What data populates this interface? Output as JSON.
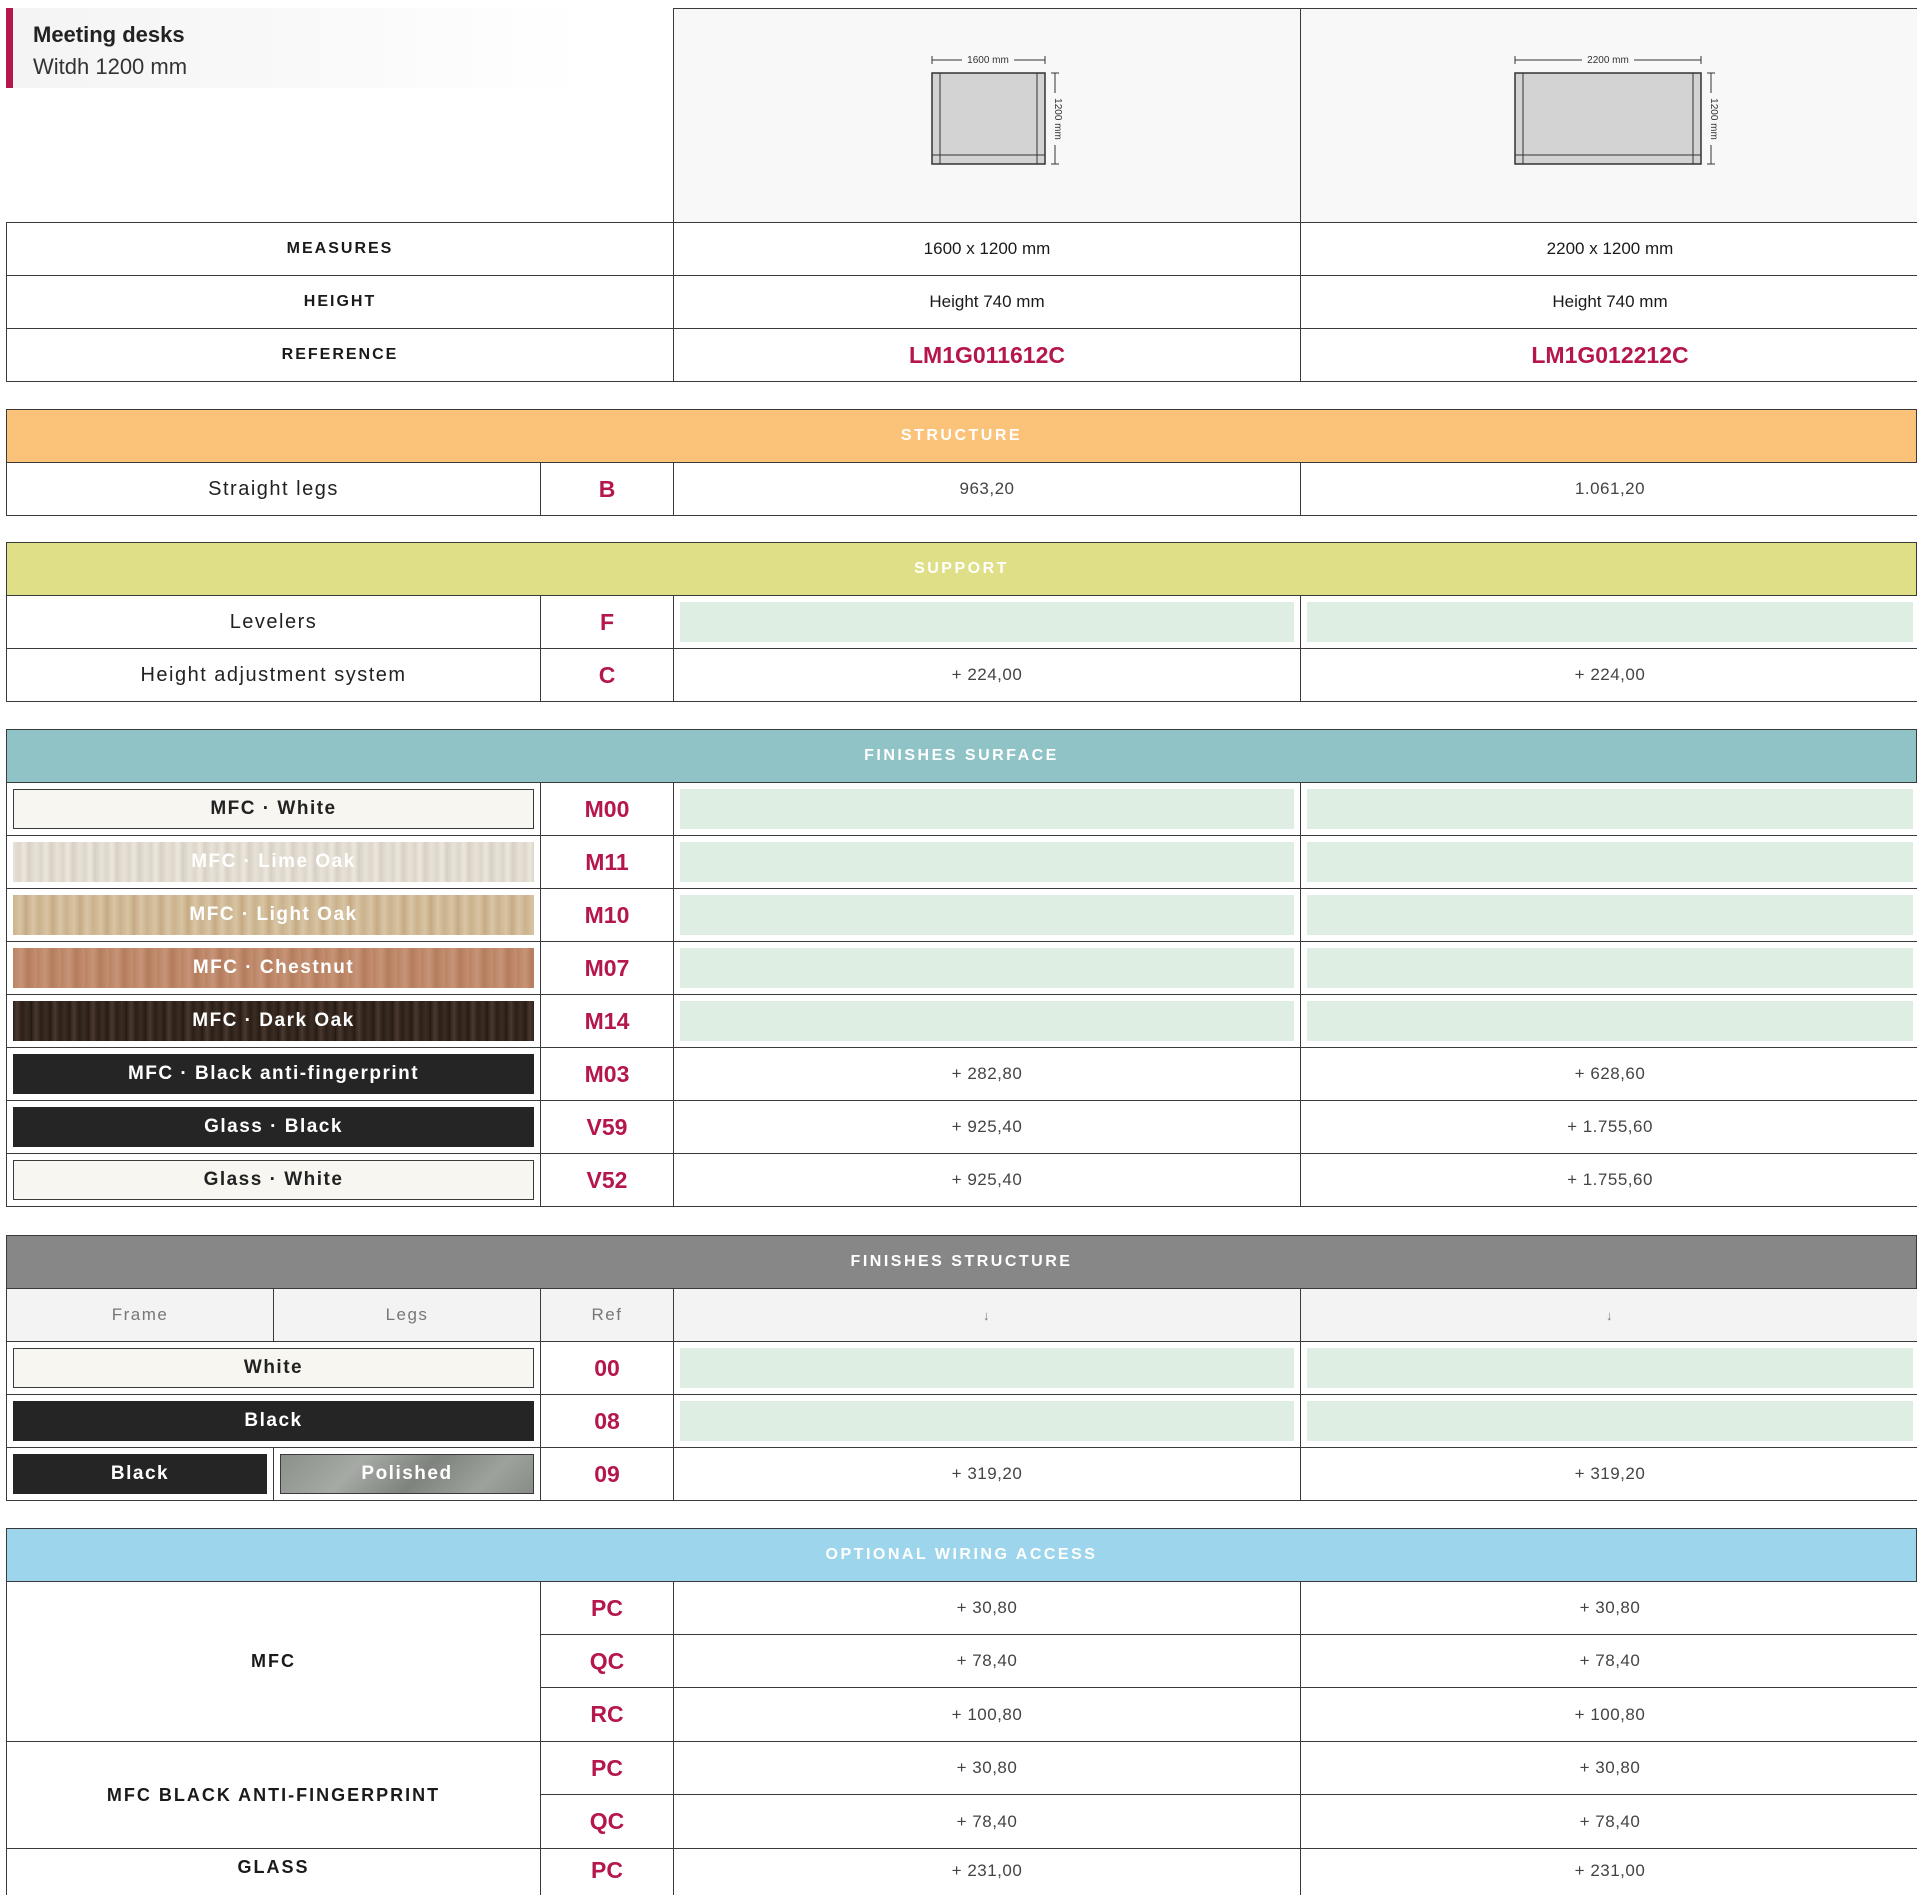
{
  "header": {
    "title": "Meeting desks",
    "subtitle": "Witdh 1200 mm",
    "accent": "#b5164b"
  },
  "products": [
    {
      "diagram_width_label": "1600 mm",
      "diagram_depth_label": "1200 mm",
      "measures": "1600 x 1200 mm",
      "height": "Height 740 mm",
      "reference": "LM1G011612C"
    },
    {
      "diagram_width_label": "2200 mm",
      "diagram_depth_label": "1200 mm",
      "measures": "2200 x 1200 mm",
      "height": "Height 740 mm",
      "reference": "LM1G012212C"
    }
  ],
  "spec_labels": {
    "measures": "MEASURES",
    "height": "HEIGHT",
    "reference": "REFERENCE"
  },
  "structure": {
    "title": "STRUCTURE",
    "color": "#fbc27a",
    "rows": [
      {
        "label": "Straight legs",
        "ref": "B",
        "prices": [
          "963,20",
          "1.061,20"
        ]
      }
    ]
  },
  "support": {
    "title": "SUPPORT",
    "color": "#dfdf88",
    "rows": [
      {
        "label": "Levelers",
        "ref": "F",
        "prices": [
          "",
          ""
        ]
      },
      {
        "label": "Height adjustment system",
        "ref": "C",
        "prices": [
          "+ 224,00",
          "+ 224,00"
        ]
      }
    ]
  },
  "finishes_surface": {
    "title": "FINISHES SURFACE",
    "color": "#8fc3c6",
    "rows": [
      {
        "label": "MFC · White",
        "ref": "M00",
        "prices": [
          "",
          ""
        ]
      },
      {
        "label": "MFC · Lime Oak",
        "ref": "M11",
        "prices": [
          "",
          ""
        ]
      },
      {
        "label": "MFC · Light Oak",
        "ref": "M10",
        "prices": [
          "",
          ""
        ]
      },
      {
        "label": "MFC · Chestnut",
        "ref": "M07",
        "prices": [
          "",
          ""
        ]
      },
      {
        "label": "MFC · Dark Oak",
        "ref": "M14",
        "prices": [
          "",
          ""
        ]
      },
      {
        "label": "MFC · Black anti-fingerprint",
        "ref": "M03",
        "prices": [
          "+ 282,80",
          "+ 628,60"
        ]
      },
      {
        "label": "Glass · Black",
        "ref": "V59",
        "prices": [
          "+ 925,40",
          "+ 1.755,60"
        ]
      },
      {
        "label": "Glass · White",
        "ref": "V52",
        "prices": [
          "+ 925,40",
          "+ 1.755,60"
        ]
      }
    ]
  },
  "finishes_structure": {
    "title": "FINISHES STRUCTURE",
    "color": "#878787",
    "columns": {
      "frame": "Frame",
      "legs": "Legs",
      "ref": "Ref",
      "arrow": "↓"
    },
    "rows": [
      {
        "frame": "White",
        "legs": "",
        "ref": "00",
        "prices": [
          "",
          ""
        ]
      },
      {
        "frame": "Black",
        "legs": "",
        "ref": "08",
        "prices": [
          "",
          ""
        ]
      },
      {
        "frame": "Black",
        "legs": "Polished",
        "ref": "09",
        "prices": [
          "+ 319,20",
          "+ 319,20"
        ]
      }
    ]
  },
  "wiring": {
    "title": "OPTIONAL WIRING ACCESS",
    "color": "#9dd6ec",
    "groups": [
      {
        "label": "MFC",
        "rows": [
          {
            "ref": "PC",
            "prices": [
              "+ 30,80",
              "+ 30,80"
            ]
          },
          {
            "ref": "QC",
            "prices": [
              "+ 78,40",
              "+ 78,40"
            ]
          },
          {
            "ref": "RC",
            "prices": [
              "+ 100,80",
              "+ 100,80"
            ]
          }
        ]
      },
      {
        "label": "MFC BLACK ANTI-FINGERPRINT",
        "rows": [
          {
            "ref": "PC",
            "prices": [
              "+ 30,80",
              "+ 30,80"
            ]
          },
          {
            "ref": "QC",
            "prices": [
              "+ 78,40",
              "+ 78,40"
            ]
          }
        ]
      },
      {
        "label": "GLASS",
        "rows": [
          {
            "ref": "PC",
            "prices": [
              "+ 231,00",
              "+ 231,00"
            ]
          }
        ]
      }
    ]
  }
}
